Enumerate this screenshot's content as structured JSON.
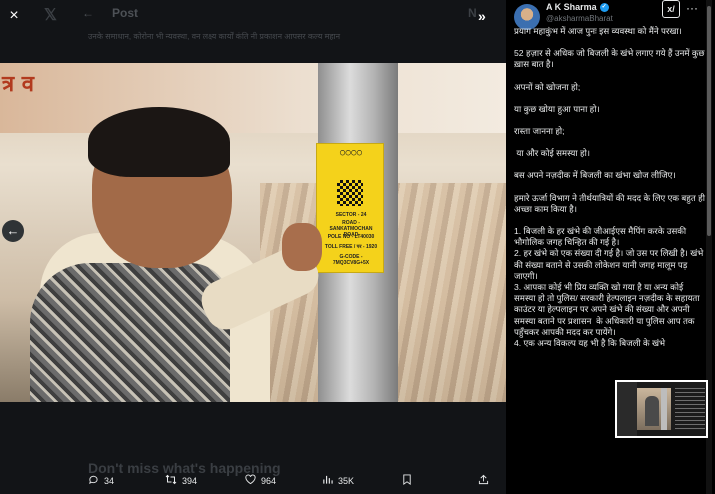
{
  "viewer": {
    "background_header": "Post",
    "background_dm": "N",
    "background_text": "उनके समाधान, कोरोना भी न्यवस्था, वन लक्ष्य कार्यों कंति नी प्रकाशन आपसर कल्य महान",
    "background_footer": "Don't miss what's happening",
    "close_icon": "×",
    "x_logo": "𝕏",
    "expand_icon": "»",
    "prev_icon": "←",
    "photo": {
      "banner_text": "त्र व",
      "sign_lines": [
        "SECTOR - 24",
        "ROAD - SANKATMOCHAN ROAD",
        "POLE NO - LT40030",
        "TOLL FREE / पर - 1920",
        "G-CODE - 7MQ3CV8G+5X"
      ]
    }
  },
  "actions": {
    "reply_count": "34",
    "retweet_count": "394",
    "like_count": "964",
    "views_count": "35K"
  },
  "author": {
    "name": "A K Sharma",
    "handle": "@aksharmaBharat",
    "grok_label": "x/",
    "more_icon": "···"
  },
  "post": {
    "paragraphs": [
      "प्रयाग महाकुंभ में आज पुनः इस व्यवस्था को मैंने परखा।",
      "52 हज़ार से अधिक जो बिजली के खंभे लगाए गये हैं उनमें कुछ ख़ास बात है।",
      "अपनों को खोजना हो;",
      "या कुछ खोया हुआ पाना हो।",
      "रास्ता जानना हो;",
      " या और कोई समस्या हो।",
      "बस अपने नज़दीक में बिजली का खंभा खोज लीजिए।",
      "हमारे ऊर्जा विभाग ने तीर्थयात्रियों की मदद के लिए एक बहुत ही अच्छा काम किया है।"
    ],
    "list": [
      "1. बिजली के हर खंभे की जीआईएस मैपिंग करके उसकी भौगोलिक जगह चिन्हित की गई है।",
      "2. हर खंभे को एक संख्या दी गई है। जो उस पर लिखी है। खंभे की संख्या बताने से उसकी लोकेशन यानी जगह मालूम पड़ जाएगी।",
      "3. आपका कोई भी प्रिय व्यक्ति खो गया है या अन्य कोई समस्या हो तो पुलिस/ सरकारी हेल्पलाइन नज़दीक के सहायता काउंटर या हेल्पलाइन पर अपने खंभे की संख्या और अपनी समस्या बताने पर प्रशासन  के अधिकारी या पुलिस आप तक पहुँचकर आपकी मदद कर पायेंगे।",
      "4. एक अन्य विकल्प यह भी है कि बिजली के खंभे"
    ]
  }
}
